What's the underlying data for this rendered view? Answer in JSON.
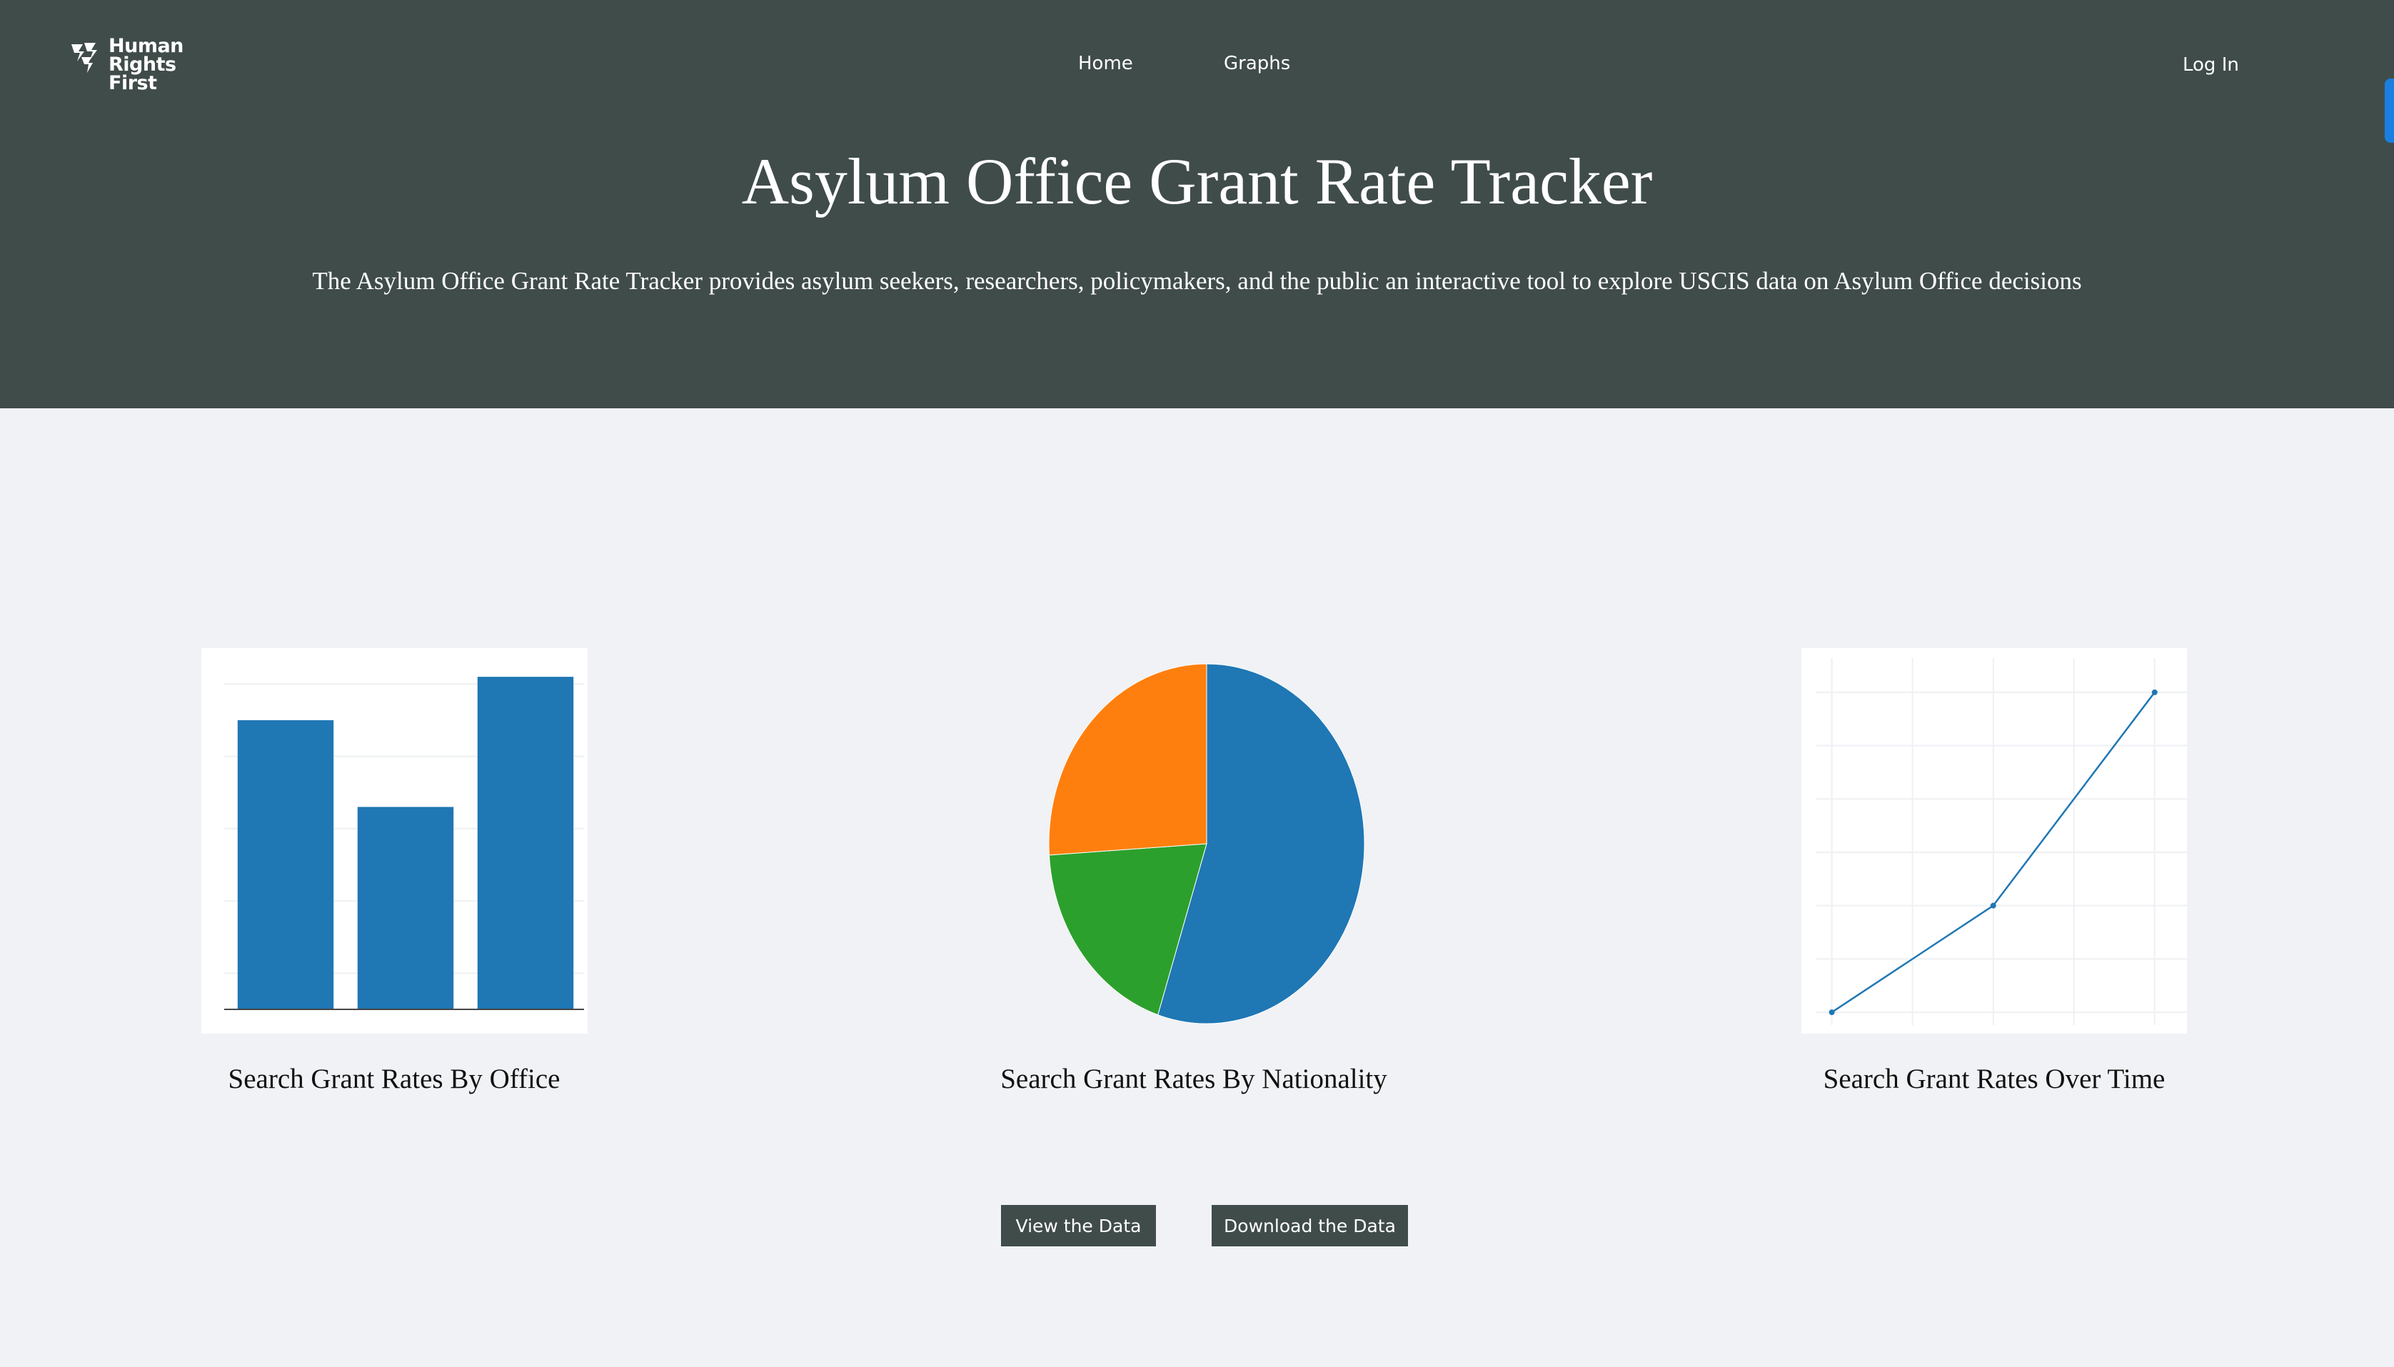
{
  "header": {
    "logo": {
      "icon": "human-rights-first-logo",
      "lines": [
        "Human",
        "Rights",
        "First"
      ]
    },
    "nav": [
      {
        "label": "Home"
      },
      {
        "label": "Graphs"
      }
    ],
    "login_label": "Log In",
    "title": "Asylum Office Grant Rate Tracker",
    "subtitle": "The Asylum Office Grant Rate Tracker provides asylum seekers, researchers, policymakers, and the public an interactive tool to explore USCIS data on Asylum Office decisions"
  },
  "cards": [
    {
      "label": "Search Grant Rates By Office"
    },
    {
      "label": "Search Grant Rates By Nationality"
    },
    {
      "label": "Search Grant Rates Over Time"
    }
  ],
  "buttons": {
    "view_label": "View the Data",
    "download_label": "Download the Data"
  },
  "colors": {
    "header_bg": "#404c4a",
    "page_bg": "#f0f2f5",
    "blue": "#1f77b4",
    "orange": "#ff7f0e",
    "green": "#2ca02c"
  },
  "chart_data": [
    {
      "type": "bar",
      "categories": [
        "",
        "",
        ""
      ],
      "values": [
        40,
        28,
        46
      ],
      "ylim": [
        0,
        47
      ],
      "grid": true
    },
    {
      "type": "pie",
      "values": [
        55,
        19,
        26
      ],
      "colors": [
        "#1f77b4",
        "#2ca02c",
        "#ff7f0e"
      ]
    },
    {
      "type": "line",
      "x": [
        1,
        2,
        3
      ],
      "y": [
        10,
        15,
        25
      ],
      "xlim": [
        0.9,
        3.2
      ],
      "ylim": [
        9.4,
        26.6
      ],
      "grid": true
    }
  ]
}
